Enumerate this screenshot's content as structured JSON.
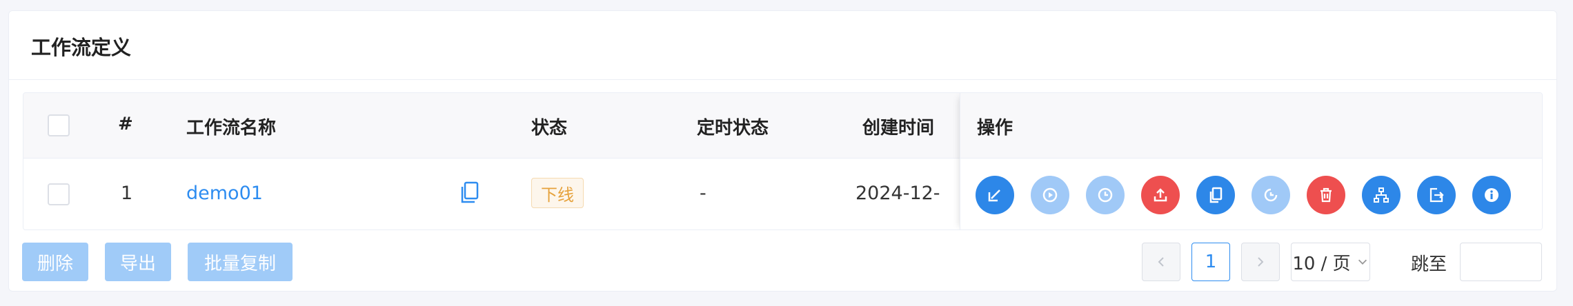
{
  "card": {
    "title": "工作流定义"
  },
  "table": {
    "headers": {
      "index": "#",
      "name": "工作流名称",
      "status": "状态",
      "schedule_status": "定时状态",
      "created_time": "创建时间",
      "operations": "操作"
    },
    "rows": [
      {
        "index": "1",
        "name": "demo01",
        "status": "下线",
        "schedule_status": "-",
        "created_time": "2024-12-"
      }
    ]
  },
  "operation_icons": [
    "edit-icon",
    "run-icon",
    "timing-icon",
    "release-icon",
    "copy-icon",
    "schedule-icon",
    "delete-icon",
    "tree-icon",
    "export-icon",
    "info-icon"
  ],
  "batch": {
    "delete_label": "删除",
    "export_label": "导出",
    "copy_label": "批量复制"
  },
  "pagination": {
    "current_page": "1",
    "page_size": "10 / 页",
    "jump_label": "跳至",
    "jump_value": ""
  },
  "colors": {
    "primary": "#2d87e8",
    "primary_light": "#a0c9f7",
    "danger": "#ee4f4f",
    "warning": "#e6a23c"
  }
}
